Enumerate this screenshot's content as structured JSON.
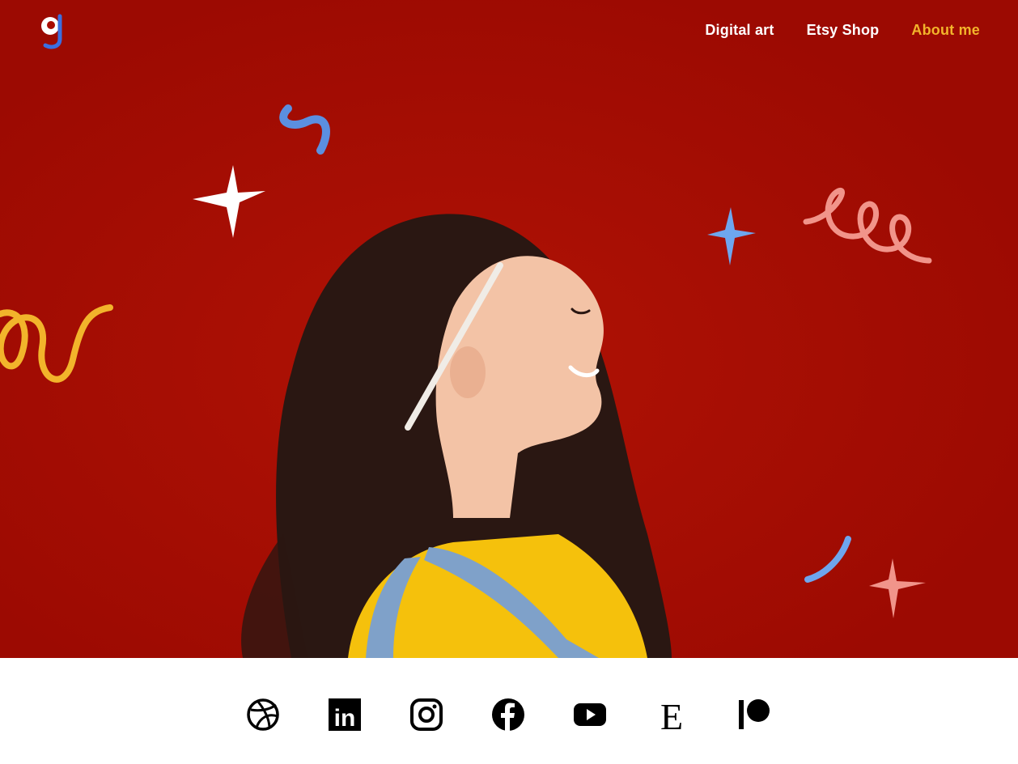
{
  "brand": {
    "logo_letter": "g",
    "logo_icon": "g-monogram-logo"
  },
  "nav": {
    "items": [
      {
        "label": "Digital art",
        "active": false
      },
      {
        "label": "Etsy Shop",
        "active": false
      },
      {
        "label": "About me",
        "active": true
      }
    ]
  },
  "hero": {
    "image": "portrait-profile-smiling-woman-with-doodles"
  },
  "social": {
    "icons": [
      "dribbble-icon",
      "linkedin-icon",
      "instagram-icon",
      "facebook-icon",
      "youtube-icon",
      "etsy-icon",
      "patreon-icon"
    ],
    "linkedin_text": "in",
    "etsy_text": "E"
  },
  "colors": {
    "hero_bg": "#a80c02",
    "nav_text": "#ffffff",
    "nav_active": "#f2b42b",
    "accent_blue": "#5b8fe0",
    "accent_pink": "#f1948a",
    "accent_yellow": "#f2b42b"
  }
}
